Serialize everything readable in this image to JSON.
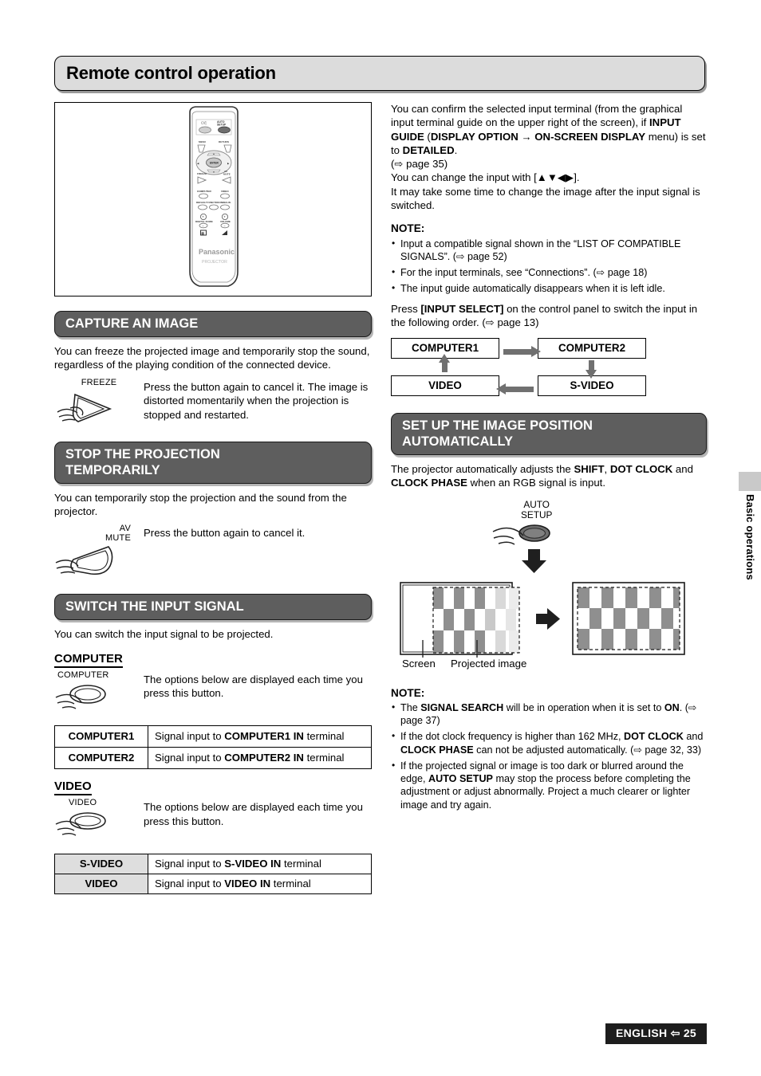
{
  "page": {
    "title": "Remote control operation",
    "side_tab_label": "Basic operations",
    "footer_language": "ENGLISH",
    "footer_arrow": "⇦",
    "footer_page": "25",
    "accent_header_bg": "#5e5e5e",
    "title_bar_bg": "#dcdcdc",
    "arrow_fill": "#707070"
  },
  "remote": {
    "figure_name": "remote-control-illustration",
    "brand": "Panasonic",
    "brand_sub": "PROJECTOR",
    "buttons": {
      "power": "⏻/|",
      "auto_setup": "AUTO SETUP",
      "menu": "MENU",
      "return": "RETURN",
      "enter": "ENTER",
      "freeze": "FREEZE",
      "av_mute": "AV MUTE",
      "computer": "COMPUTER",
      "video": "VIDEO",
      "default": "DEFAULT",
      "function": "FUNCTION",
      "index_window": "INDEX-WIN.",
      "digital_zoom": "DIGITAL ZOOM",
      "volume": "VOLUME",
      "plus": "+",
      "minus": "−"
    }
  },
  "left": {
    "capture": {
      "heading": "CAPTURE AN IMAGE",
      "intro": "You can freeze the projected image and temporarily stop the sound, regardless of the playing condition of the connected device.",
      "button_label": "FREEZE",
      "text": "Press the button again to cancel it. The image is distorted momentarily when the projection is stopped and restarted."
    },
    "stop": {
      "heading_line1": "STOP THE PROJECTION",
      "heading_line2": "TEMPORARILY",
      "intro": "You can temporarily stop the projection and the sound from the projector.",
      "button_label_line1": "AV",
      "button_label_line2": "MUTE",
      "text": "Press the button again to cancel it."
    },
    "switch": {
      "heading": "SWITCH THE INPUT SIGNAL",
      "intro": "You can switch the input signal to be projected.",
      "computer": {
        "subhead": "COMPUTER",
        "button_label": "COMPUTER",
        "text": "The options below are displayed each time you press this button.",
        "rows": [
          {
            "key": "COMPUTER1",
            "pre": "Signal input to ",
            "bold": "COMPUTER1 IN",
            "post": " terminal"
          },
          {
            "key": "COMPUTER2",
            "pre": "Signal input to ",
            "bold": "COMPUTER2 IN",
            "post": " terminal"
          }
        ]
      },
      "video": {
        "subhead": "VIDEO",
        "button_label": "VIDEO",
        "text": "The options below are displayed each time you press this button.",
        "rows": [
          {
            "key": "S-VIDEO",
            "pre": "Signal input to ",
            "bold": "S-VIDEO IN",
            "post": " terminal"
          },
          {
            "key": "VIDEO",
            "pre": "Signal input to ",
            "bold": "VIDEO IN",
            "post": " terminal"
          }
        ]
      }
    }
  },
  "right": {
    "intro": {
      "s1": "You can confirm the selected input terminal (from the graphical input terminal guide on the upper right of the screen), if ",
      "b1": "INPUT GUIDE",
      "s2": " (",
      "b2": "DISPLAY OPTION",
      "s3": " → ",
      "b3": "ON-SCREEN DISPLAY",
      "s4": " menu) is set to ",
      "b4": "DETAILED",
      "s5": ".",
      "ref": "(⇨ page 35)",
      "s6": "You can change the input with [▲▼◀▶].",
      "s7": "It may take some time to change the image after the input signal is switched."
    },
    "note_heading": "NOTE:",
    "notes": [
      "Input a compatible signal shown in the “LIST OF COMPATIBLE SIGNALS”. (⇨ page 52)",
      "For the input terminals, see “Connections”. (⇨ page 18)",
      "The input guide automatically disappears when it is left idle."
    ],
    "press_line": {
      "pre": "Press ",
      "bold": "[INPUT SELECT]",
      "post": " on the control panel to switch the input in the following order. (⇨ page 13)"
    },
    "flow": {
      "computer1": "COMPUTER1",
      "computer2": "COMPUTER2",
      "s_video": "S-VIDEO",
      "video": "VIDEO"
    },
    "autosetup": {
      "heading_line1": "SET UP THE IMAGE POSITION",
      "heading_line2": "AUTOMATICALLY",
      "intro": {
        "s1": "The projector automatically adjusts the ",
        "b1": "SHIFT",
        "s2": ", ",
        "b2": "DOT CLOCK",
        "s3": " and ",
        "b3": "CLOCK PHASE",
        "s4": " when an RGB signal is input."
      },
      "button_label_line1": "AUTO",
      "button_label_line2": "SETUP",
      "label_screen": "Screen",
      "label_projected": "Projected image"
    },
    "note2_heading": "NOTE:",
    "notes2": [
      {
        "pre": "The ",
        "bold": "SIGNAL SEARCH",
        "mid": " will be in operation when it is set to ",
        "bold2": "ON",
        "post": ". (⇨ page 37)"
      },
      {
        "pre": "If the dot clock frequency is higher than 162 MHz, ",
        "bold": "DOT CLOCK",
        "mid": " and ",
        "bold2": "CLOCK PHASE",
        "post": " can not be adjusted automatically. (⇨ page 32, 33)"
      },
      {
        "pre": "If the projected signal or image is too dark or blurred around the edge, ",
        "bold": "AUTO SETUP",
        "mid": " may stop the process before completing the adjustment or adjust abnormally. Project a much clearer or lighter image and try again.",
        "bold2": "",
        "post": ""
      }
    ]
  }
}
